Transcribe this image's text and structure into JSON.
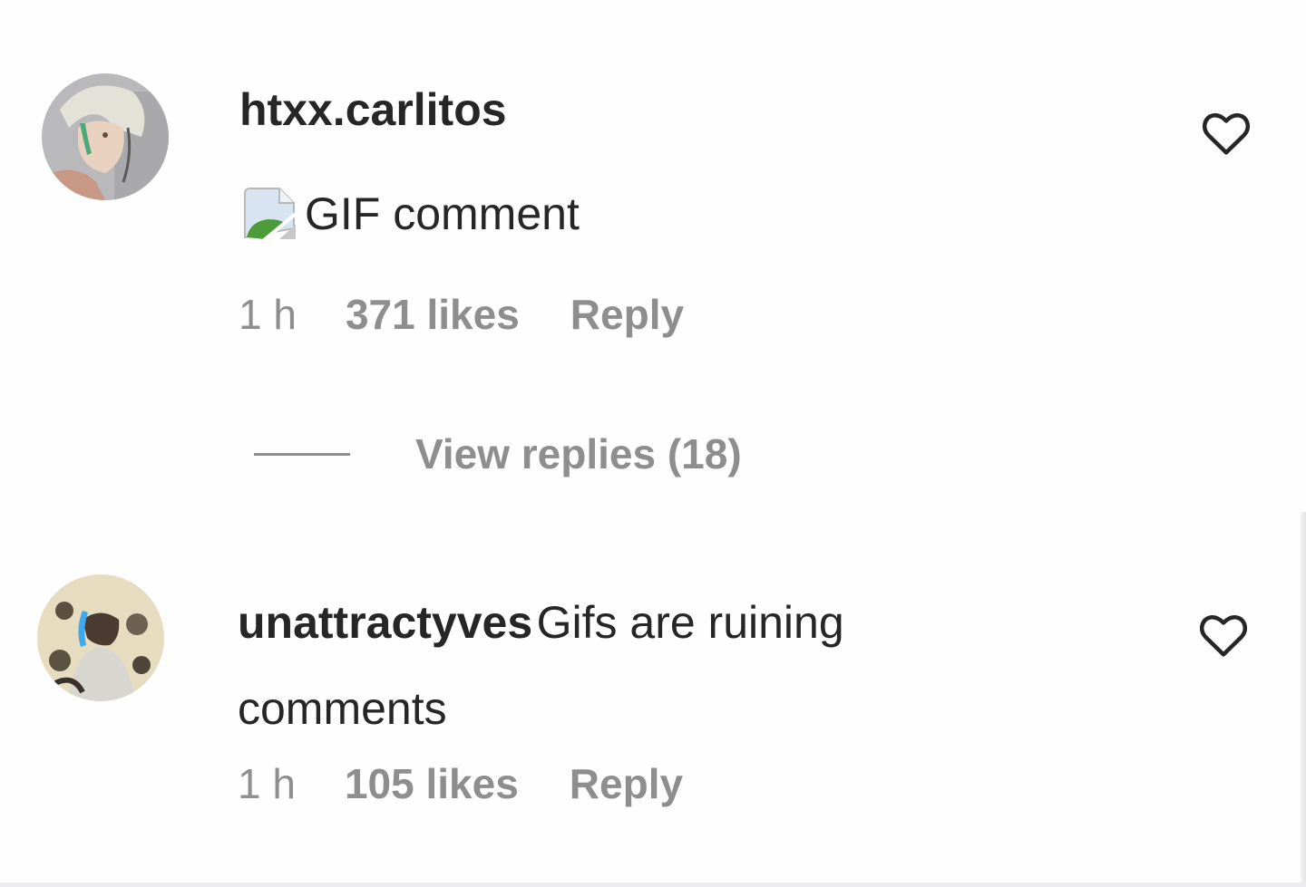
{
  "comments": [
    {
      "username": "htxx.carlitos",
      "gif_placeholder_label": "GIF comment",
      "avatar_icon": "avatar-anime-character",
      "time": "1 h",
      "likes": "371 likes",
      "reply_label": "Reply",
      "like_icon": "heart-outline-icon",
      "view_replies_label": "View replies (18)"
    },
    {
      "username": "unattractyves",
      "text": "Gifs are ruining comments",
      "avatar_icon": "avatar-photo",
      "time": "1 h",
      "likes": "105 likes",
      "reply_label": "Reply",
      "like_icon": "heart-outline-icon"
    }
  ],
  "colors": {
    "text_primary": "#262626",
    "text_secondary": "#8e8e8e",
    "background": "#fefefe"
  }
}
